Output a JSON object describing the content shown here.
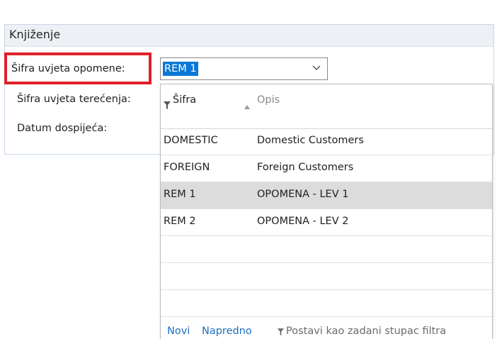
{
  "section": {
    "title": "Knjiženje"
  },
  "fields": {
    "reminder_terms_label": "Šifra uvjeta opomene:",
    "payment_terms_label": "Šifra uvjeta terećenja:",
    "due_date_label": "Datum dospijeća:",
    "reminder_terms_value": "REM 1"
  },
  "lookup": {
    "columns": {
      "code": "Šifra",
      "description": "Opis"
    },
    "rows": [
      {
        "code": "DOMESTIC",
        "description": "Domestic Customers",
        "selected": false
      },
      {
        "code": "FOREIGN",
        "description": "Foreign Customers",
        "selected": false
      },
      {
        "code": "REM 1",
        "description": "OPOMENA - LEV 1",
        "selected": true
      },
      {
        "code": "REM 2",
        "description": "OPOMENA - LEV 2",
        "selected": false
      }
    ],
    "footer": {
      "new_label": "Novi",
      "advanced_label": "Napredno",
      "set_default_filter_label": "Postavi kao zadani stupac filtra"
    }
  },
  "colors": {
    "highlight": "#e0202a",
    "selection": "#0b78d7",
    "link": "#1c6fbf",
    "selected_row": "#dcdcdc"
  },
  "icons": {
    "combo_chevron": "chevron-down-icon",
    "code_column_filter": "filter-icon",
    "description_sort": "sort-ascending-icon",
    "footer_filter": "filter-icon"
  }
}
